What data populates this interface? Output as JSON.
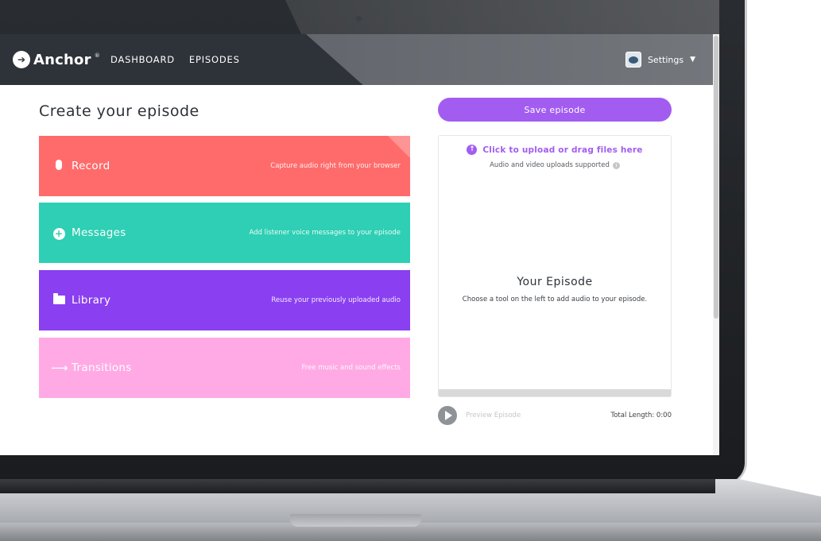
{
  "app": {
    "brand": "Anchor",
    "brand_mark": "®",
    "logo_icon": "anchor-logo-icon"
  },
  "nav": {
    "links": [
      {
        "label": "DASHBOARD"
      },
      {
        "label": "EPISODES"
      }
    ],
    "settings_label": "Settings",
    "settings_icon": "chevron-down-icon"
  },
  "page": {
    "title": "Create your episode"
  },
  "tools": [
    {
      "label": "Record",
      "description": "Capture audio right from your browser",
      "icon": "microphone-icon",
      "color": "#ff6b6b"
    },
    {
      "label": "Messages",
      "description": "Add listener voice messages to your episode",
      "icon": "message-bubble-icon",
      "color": "#2ecfb4"
    },
    {
      "label": "Library",
      "description": "Reuse your previously uploaded audio",
      "icon": "folder-icon",
      "color": "#8a3ff1"
    },
    {
      "label": "Transitions",
      "description": "Free music and sound effects",
      "icon": "arrow-right-icon",
      "color": "#ffaae5"
    }
  ],
  "episode": {
    "save_label": "Save episode",
    "upload_label": "Click to upload or drag files here",
    "upload_sub": "Audio and video uploads supported",
    "title": "Your Episode",
    "subtitle": "Choose a tool on the left to add audio to your episode.",
    "preview_label": "Preview Episode",
    "total_length": "Total Length: 0:00"
  },
  "colors": {
    "accent": "#a25df0",
    "navbar": "#2e3239"
  }
}
